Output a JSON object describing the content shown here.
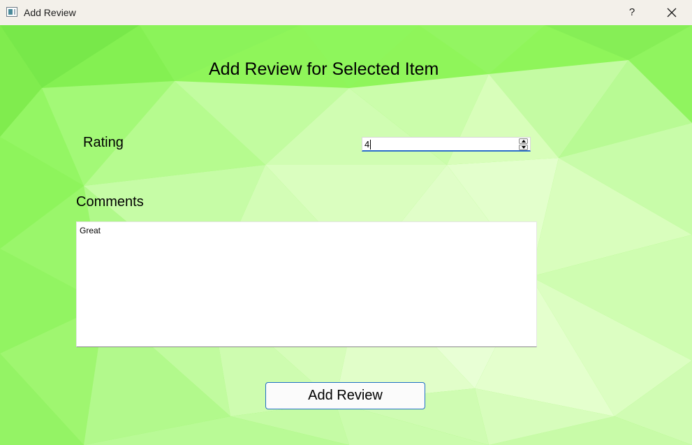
{
  "window": {
    "title": "Add Review",
    "help_glyph": "?",
    "icons": {
      "app": "app-window-icon",
      "close": "close-icon"
    }
  },
  "form": {
    "heading": "Add Review for Selected Item",
    "rating_label": "Rating",
    "rating_value": "4",
    "comments_label": "Comments",
    "comments_value": "Great",
    "submit_label": "Add Review"
  },
  "colors": {
    "background": "#8ff55a",
    "accent": "#1f6fc4",
    "titlebar": "#f3f0ea"
  }
}
